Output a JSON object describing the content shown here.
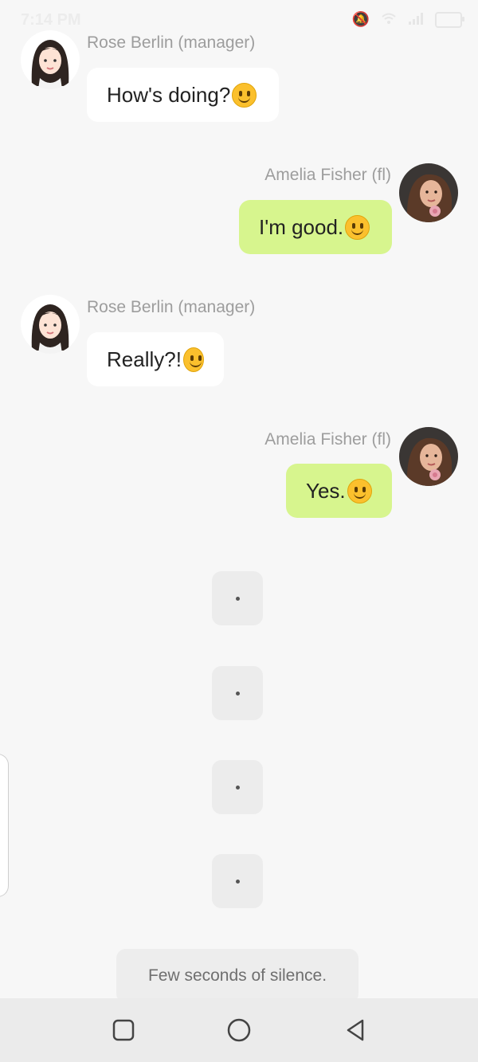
{
  "status_bar": {
    "time": "7:14 PM",
    "icons": [
      "usb-icon",
      "mute-bell-icon",
      "wifi-icon",
      "signal-icon",
      "data-speed-icon",
      "battery-icon"
    ]
  },
  "messages": [
    {
      "sender": "Rose Berlin (manager)",
      "side": "left",
      "text": "How's doing?",
      "emoji": "slightly-smiling-face"
    },
    {
      "sender": "Amelia Fisher (fl)",
      "side": "right",
      "text": "I'm good.",
      "emoji": "slightly-smiling-face"
    },
    {
      "sender": "Rose Berlin (manager)",
      "side": "left",
      "text": "Really?!",
      "emoji": "slightly-smiling-face"
    },
    {
      "sender": "Amelia Fisher (fl)",
      "side": "right",
      "text": "Yes.",
      "emoji": "slightly-smiling-face"
    }
  ],
  "typing_indicators": [
    {
      "text": "."
    },
    {
      "text": "."
    },
    {
      "text": "."
    },
    {
      "text": "."
    }
  ],
  "silence_notice": "Few seconds of silence.",
  "nav_bar": {
    "buttons": [
      "recent-apps-button",
      "home-button",
      "back-button"
    ]
  },
  "colors": {
    "background": "#f7f7f7",
    "incoming_bubble": "#ffffff",
    "outgoing_bubble": "#d7f58e",
    "sender_name": "#9d9d9d",
    "typing_bubble": "#ececec",
    "nav_bar": "#ebebeb"
  }
}
